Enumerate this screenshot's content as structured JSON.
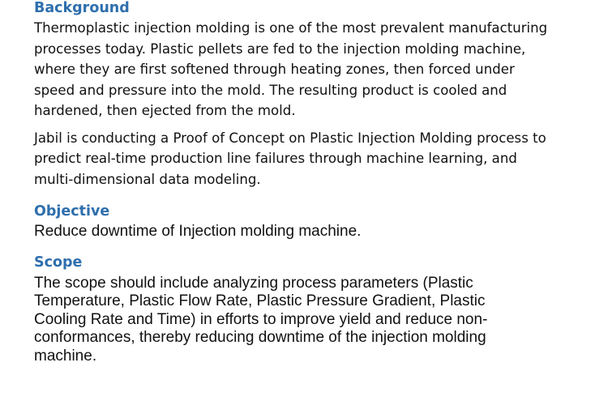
{
  "document": {
    "background": {
      "heading": "Background",
      "paragraph_lines": [
        "Thermoplastic injection molding is one of the most prevalent manufacturing",
        "processes today.  Plastic pellets are fed to the injection molding machine,",
        "where they are first softened through heating zones, then forced under",
        "speed and pressure into the mold. The resulting product is cooled and",
        "hardened, then ejected from the mold."
      ],
      "jabil_lines": [
        "Jabil is conducting a Proof of Concept on Plastic Injection Molding process to",
        "predict real-time production line failures through machine learning, and",
        "multi-dimensional data modeling."
      ]
    },
    "objective": {
      "heading": "Objective",
      "text": "Reduce downtime of Injection molding machine."
    },
    "scope": {
      "heading": "Scope",
      "lines": [
        "The scope should include analyzing process parameters (Plastic",
        "Temperature, Plastic Flow Rate, Plastic Pressure Gradient, Plastic",
        "Cooling Rate and Time) in efforts to improve yield and reduce non-",
        "conformances, thereby reducing downtime of the injection molding",
        "machine."
      ]
    }
  },
  "colors": {
    "heading": "#2e6fad",
    "body_text": "#111111",
    "background": "#ffffff"
  }
}
